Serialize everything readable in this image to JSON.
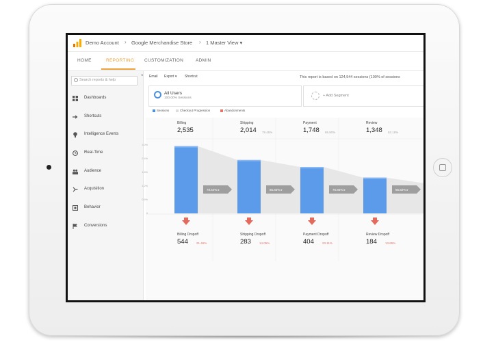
{
  "breadcrumb": {
    "account": "Demo Account",
    "property": "Google Merchandise Store",
    "view": "1 Master View ▾"
  },
  "tabs": [
    {
      "label": "HOME",
      "active": false
    },
    {
      "label": "REPORTING",
      "active": true
    },
    {
      "label": "CUSTOMIZATION",
      "active": false
    },
    {
      "label": "ADMIN",
      "active": false
    }
  ],
  "sidebar": {
    "search_placeholder": "Search reports & help",
    "items": [
      {
        "label": "Dashboards",
        "icon": "dashboard-grid-icon"
      },
      {
        "label": "Shortcuts",
        "icon": "arrow-right-icon"
      },
      {
        "label": "Intelligence Events",
        "icon": "lightbulb-icon"
      },
      {
        "label": "Real-Time",
        "icon": "clock-icon"
      },
      {
        "label": "Audience",
        "icon": "people-icon"
      },
      {
        "label": "Acquisition",
        "icon": "acquisition-arrows-icon"
      },
      {
        "label": "Behavior",
        "icon": "behavior-square-icon"
      },
      {
        "label": "Conversions",
        "icon": "flag-icon"
      }
    ]
  },
  "toolbar": {
    "email": "Email",
    "export": "Export ▾",
    "shortcut": "Shortcut",
    "report_note": "This report is based on 124,944 sessions (100% of sessions"
  },
  "segment": {
    "name": "All Users",
    "sub": "100.00% Sessions",
    "add_label": "+ Add Segment"
  },
  "legend": [
    {
      "label": "Sessions",
      "color": "#4a90e2"
    },
    {
      "label": "Checkout Progression",
      "color": "#dddddd"
    },
    {
      "label": "Abandonments",
      "color": "#e2766e"
    }
  ],
  "colors": {
    "accent": "#f0a13a",
    "bar": "#5b9bea",
    "bar_top": "#86b7f2",
    "drop_arrow": "#e36b5d",
    "progression": "#e7e7e7"
  },
  "chart_data": {
    "type": "bar",
    "title": "",
    "y_ticks": [
      "3.0%",
      "2.4%",
      "1.8%",
      "1.2%",
      "0.6%",
      "0"
    ],
    "steps": [
      {
        "label": "Billing",
        "value": "2,535",
        "pct": "",
        "sessions": 2535,
        "progression": "78.54%"
      },
      {
        "label": "Shipping",
        "value": "2,014",
        "pct": "79.45%",
        "sessions": 2014,
        "progression": "85.85%"
      },
      {
        "label": "Payment",
        "value": "1,748",
        "pct": "86.80%",
        "sessions": 1748,
        "progression": "76.85%"
      },
      {
        "label": "Review",
        "value": "1,348",
        "pct": "53.18%",
        "sessions": 1348,
        "progression": "86.82%"
      }
    ],
    "dropoffs": [
      {
        "label": "Billing Dropoff",
        "value": "544",
        "pct": "21.46%"
      },
      {
        "label": "Shipping Dropoff",
        "value": "283",
        "pct": "14.05%"
      },
      {
        "label": "Payment Dropoff",
        "value": "404",
        "pct": "23.11%"
      },
      {
        "label": "Review Dropoff",
        "value": "184",
        "pct": "13.65%"
      }
    ]
  }
}
